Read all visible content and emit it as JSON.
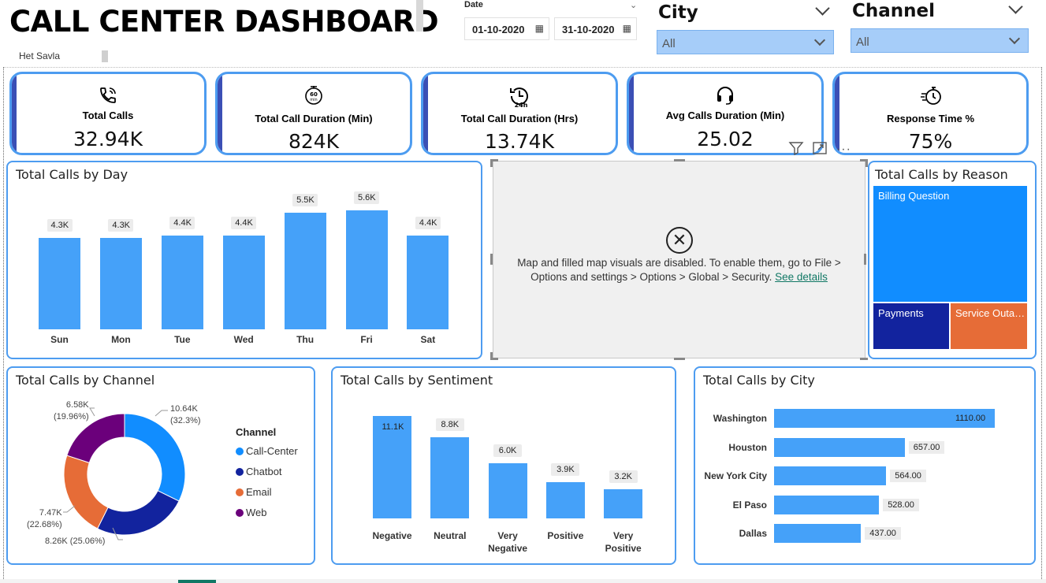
{
  "header": {
    "title": "CALL CENTER DASHBOARD",
    "author": "Het Savla"
  },
  "date_slicer": {
    "label": "Date",
    "start": "01-10-2020",
    "end": "31-10-2020"
  },
  "city_slicer": {
    "title": "City",
    "value": "All"
  },
  "channel_slicer": {
    "title": "Channel",
    "value": "All"
  },
  "kpis": [
    {
      "label": "Total Calls",
      "value": "32.94K",
      "icon": "phone-ringing-icon"
    },
    {
      "label": "Total Call Duration (Min)",
      "value": "824K",
      "icon": "timer-60min-icon"
    },
    {
      "label": "Total Call Duration (Hrs)",
      "value": "13.74K",
      "icon": "clock-24h-icon"
    },
    {
      "label": "Avg Calls Duration (Min)",
      "value": "25.02",
      "icon": "headset-icon"
    },
    {
      "label": "Response Time %",
      "value": "75%",
      "icon": "stopwatch-fast-icon"
    }
  ],
  "map": {
    "message": "Map and filled map visuals are disabled. To enable them, go to File > Options and settings > Options > Global > Security.",
    "link": "See details"
  },
  "treemap": {
    "title": "Total Calls by Reason",
    "items": [
      {
        "label": "Billing Question",
        "color": "#118dff"
      },
      {
        "label": "Payments",
        "color": "#12239e"
      },
      {
        "label": "Service Outa…",
        "color": "#e66c37"
      }
    ]
  },
  "chart_data": [
    {
      "type": "bar",
      "title": "Total Calls by Day",
      "categories": [
        "Sun",
        "Mon",
        "Tue",
        "Wed",
        "Thu",
        "Fri",
        "Sat"
      ],
      "values": [
        4300,
        4300,
        4400,
        4400,
        5500,
        5600,
        4400
      ],
      "labels": [
        "4.3K",
        "4.3K",
        "4.4K",
        "4.4K",
        "5.5K",
        "5.6K",
        "4.4K"
      ],
      "color": "#45a1f9"
    },
    {
      "type": "pie",
      "title": "Total Calls by Channel",
      "legend_title": "Channel",
      "categories": [
        "Call-Center",
        "Chatbot",
        "Email",
        "Web"
      ],
      "values": [
        10640,
        8260,
        7470,
        6580
      ],
      "labels": [
        "10.64K\n(32.3%)",
        "8.26K (25.06%)",
        "7.47K\n(22.68%)",
        "6.58K\n(19.96%)"
      ],
      "colors": [
        "#118dff",
        "#12239e",
        "#e66c37",
        "#6b007b"
      ]
    },
    {
      "type": "bar",
      "title": "Total Calls by Sentiment",
      "categories": [
        "Negative",
        "Neutral",
        "Very\nNegative",
        "Positive",
        "Very\nPositive"
      ],
      "values": [
        11100,
        8800,
        6000,
        3900,
        3200
      ],
      "labels": [
        "11.1K",
        "8.8K",
        "6.0K",
        "3.9K",
        "3.2K"
      ],
      "color": "#45a1f9"
    },
    {
      "type": "bar",
      "title": "Total Calls by City",
      "orientation": "horizontal",
      "categories": [
        "Washington",
        "Houston",
        "New York City",
        "El Paso",
        "Dallas"
      ],
      "values": [
        1110,
        657,
        564,
        528,
        437
      ],
      "labels": [
        "1110.00",
        "657.00",
        "564.00",
        "528.00",
        "437.00"
      ],
      "color": "#45a1f9"
    }
  ]
}
